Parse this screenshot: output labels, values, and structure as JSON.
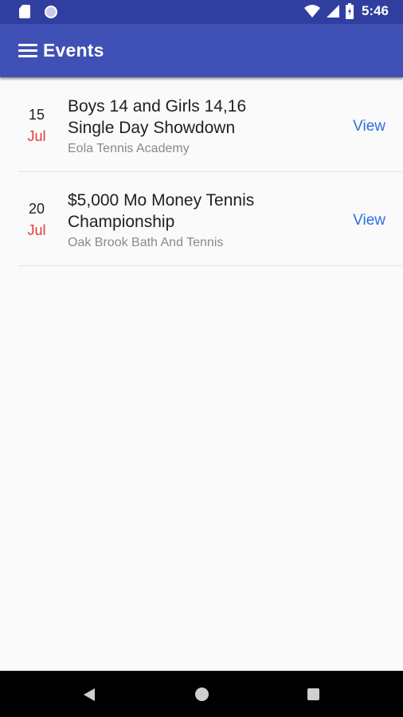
{
  "status_bar": {
    "time": "5:46",
    "icons": [
      "sd-card-icon",
      "circle-notification-icon",
      "wifi-icon",
      "cell-signal-icon",
      "battery-charging-icon"
    ]
  },
  "app_bar": {
    "title": "Events",
    "menu_icon": "hamburger-menu-icon",
    "background": "#3f51b5",
    "status_background": "#303f9f"
  },
  "events": [
    {
      "day": "15",
      "month": "Jul",
      "title_line1": "Boys 14 and Girls 14,16",
      "title_line2": "Single Day Showdown",
      "venue": "Eola Tennis Academy",
      "action": "View"
    },
    {
      "day": "20",
      "month": "Jul",
      "title_line1": "$5,000 Mo Money Tennis",
      "title_line2": "Championship",
      "venue": "Oak Brook Bath And Tennis",
      "action": "View"
    }
  ],
  "colors": {
    "month": "#e53935",
    "link": "#2d6fe0",
    "venue": "#8a8a8a"
  },
  "nav_bar": {
    "icons": [
      "back-icon",
      "home-icon",
      "recent-apps-icon"
    ]
  }
}
